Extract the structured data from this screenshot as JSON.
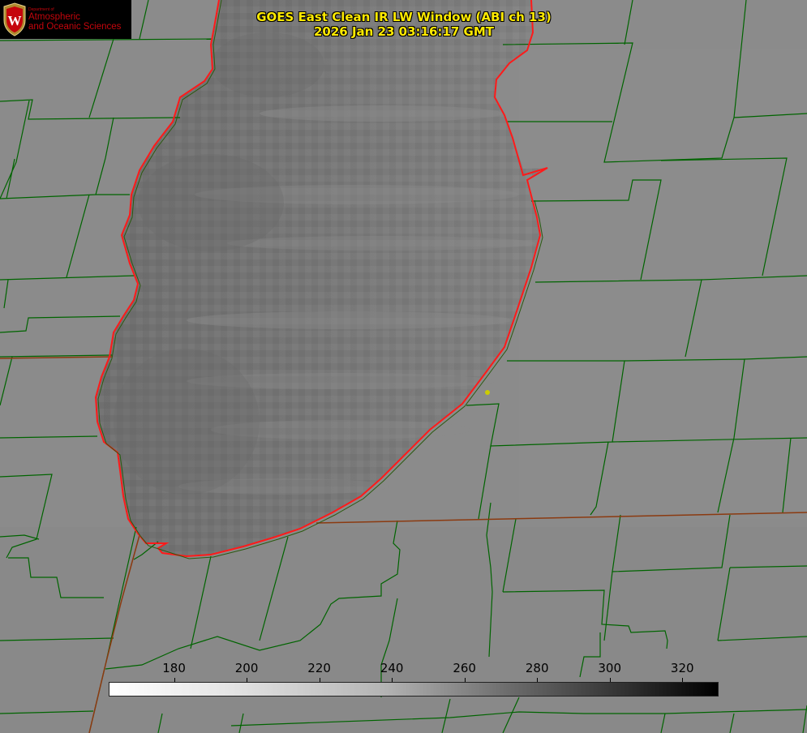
{
  "title": {
    "line1": "GOES East Clean IR LW Window (ABI ch 13)",
    "line2": "2026 Jan 23 03:16:17 GMT"
  },
  "logo": {
    "crest_letter": "W",
    "department": "Department of",
    "line1": "Atmospheric",
    "line2": "and Oceanic Sciences"
  },
  "colorbar": {
    "ticks": [
      "180",
      "200",
      "220",
      "240",
      "260",
      "280",
      "300",
      "320"
    ],
    "range_min": 162,
    "range_max": 330
  },
  "colors": {
    "land": "#8b8b8b",
    "lake": "#747474",
    "county_lines": "#006400",
    "lake_outline": "#ff1a1a",
    "title": "#ffea00",
    "point_marker": "#cccc00"
  }
}
